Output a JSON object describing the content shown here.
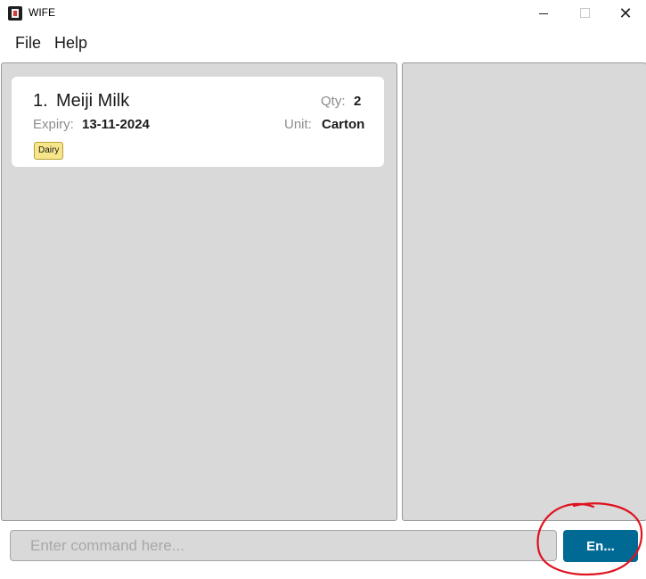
{
  "window": {
    "title": "WIFE",
    "minimize_icon": "minimize-icon",
    "maximize_icon": "maximize-icon",
    "close_icon": "close-icon"
  },
  "menu": {
    "items": [
      {
        "label": "File"
      },
      {
        "label": "Help"
      }
    ]
  },
  "food_list": {
    "items": [
      {
        "index": "1.",
        "name": "Meiji Milk",
        "qty_label": "Qty:",
        "qty": "2",
        "expiry_label": "Expiry:",
        "expiry": "13-11-2024",
        "unit_label": "Unit:",
        "unit": "Carton",
        "tags": [
          "Dairy"
        ]
      }
    ]
  },
  "command": {
    "placeholder": "Enter command here...",
    "value": "",
    "button_label": "En..."
  },
  "colors": {
    "panel_bg": "#d9d9d9",
    "card_bg": "#ffffff",
    "tag_bg": "#f7e58a",
    "button_bg": "#006994",
    "annotation": "#e0121f"
  }
}
